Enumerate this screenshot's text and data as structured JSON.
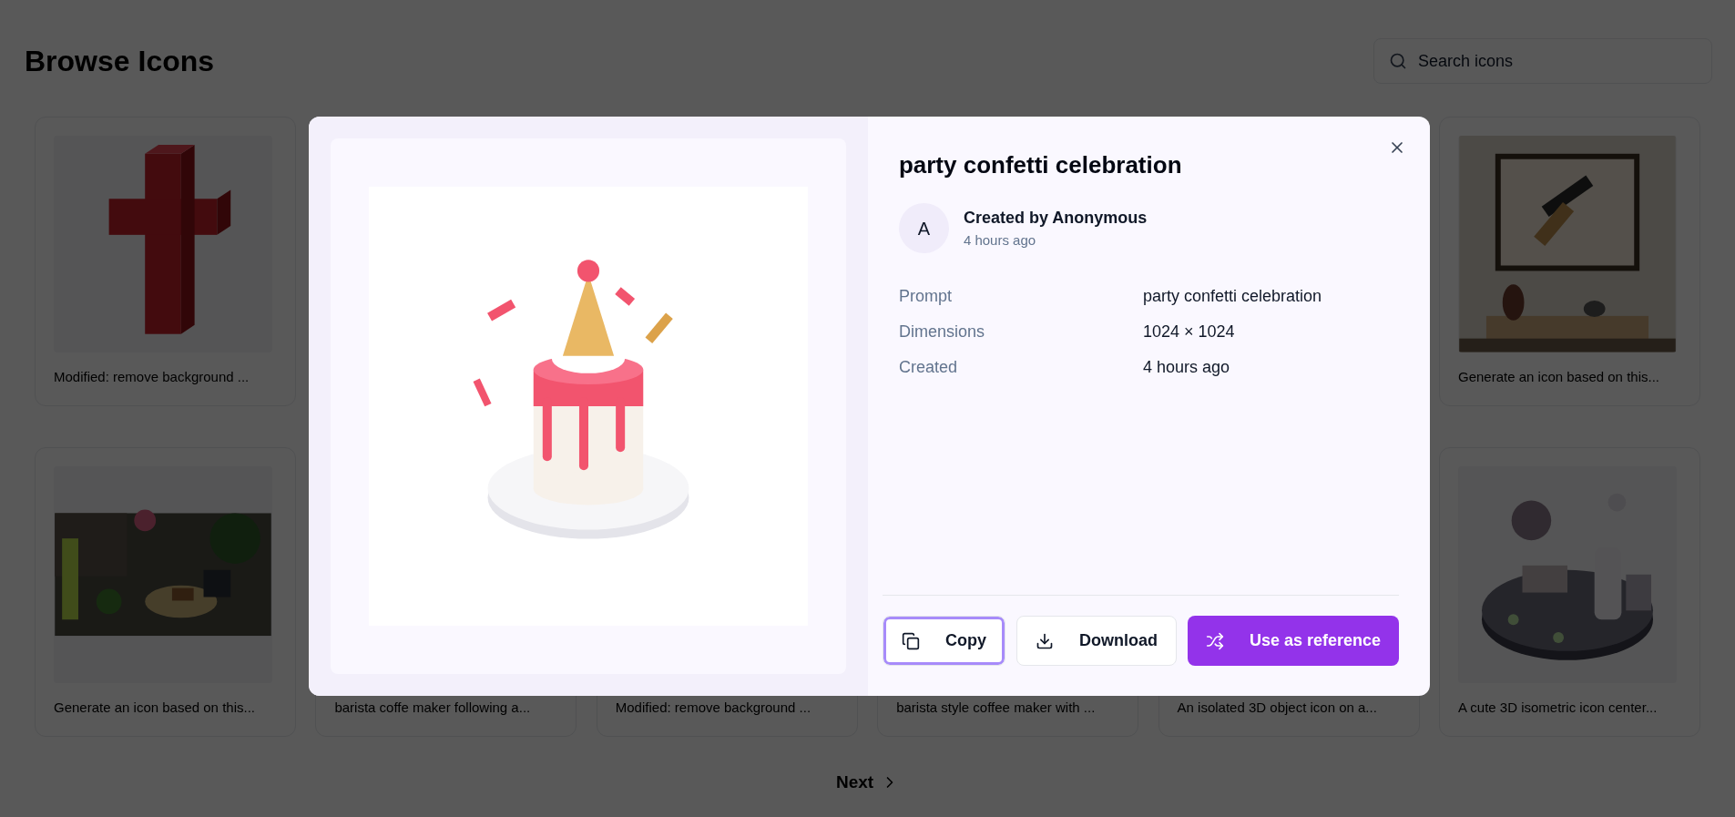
{
  "page": {
    "title": "Browse Icons",
    "search": {
      "placeholder": "Search icons"
    }
  },
  "grid": {
    "top_row": [
      {
        "caption": "Modified: remove background ...",
        "kind": "picture"
      },
      {
        "caption": "Generate an icon based on this...",
        "kind": "picture"
      }
    ],
    "bottom_row": [
      {
        "caption": "Generate an icon based on this...",
        "kind": "picture"
      },
      {
        "caption": "barista coffe maker following a...",
        "kind": "covered"
      },
      {
        "caption": "Modified: remove background ...",
        "kind": "covered"
      },
      {
        "caption": "barista style coffee maker with ...",
        "kind": "covered"
      },
      {
        "caption": "An isolated 3D object icon on a...",
        "kind": "covered"
      },
      {
        "caption": "A cute 3D isometric icon center...",
        "kind": "picture"
      }
    ]
  },
  "pagination": {
    "next": "Next"
  },
  "modal": {
    "title": "party confetti celebration",
    "creator": {
      "initial": "A",
      "name": "Created by Anonymous",
      "time": "4 hours ago"
    },
    "details": [
      {
        "label": "Prompt",
        "value": "party confetti celebration"
      },
      {
        "label": "Dimensions",
        "value": "1024 × 1024"
      },
      {
        "label": "Created",
        "value": "4 hours ago"
      }
    ],
    "buttons": [
      {
        "label": "Copy",
        "kind": "copy",
        "focused": true
      },
      {
        "label": "Download",
        "kind": "download",
        "focused": false
      },
      {
        "label": "Use as reference",
        "kind": "primary",
        "focused": false
      }
    ]
  }
}
